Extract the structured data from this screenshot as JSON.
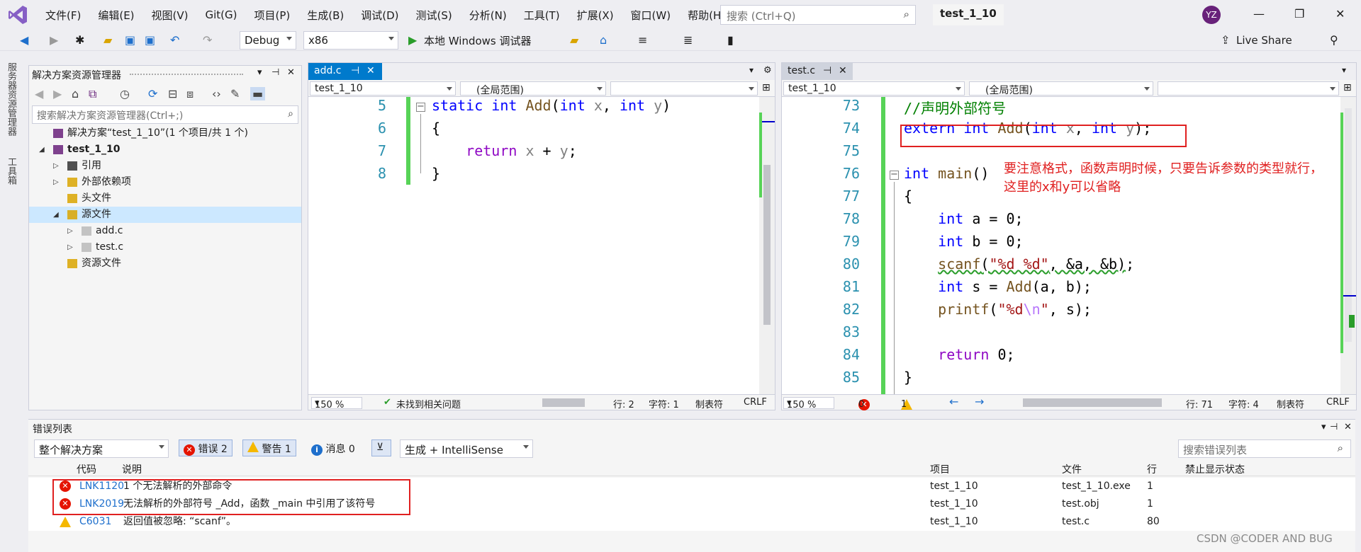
{
  "menu": [
    "文件(F)",
    "编辑(E)",
    "视图(V)",
    "Git(G)",
    "项目(P)",
    "生成(B)",
    "调试(D)",
    "测试(S)",
    "分析(N)",
    "工具(T)",
    "扩展(X)",
    "窗口(W)",
    "帮助(H)"
  ],
  "search_placeholder": "搜索 (Ctrl+Q)",
  "solution_title": "test_1_10",
  "user_initials": "YZ",
  "toolbar": {
    "config": "Debug",
    "platform": "x86",
    "run_label": "本地 Windows 调试器",
    "live_share": "Live Share"
  },
  "side_tabs": [
    "服务器资源管理器",
    "工具箱"
  ],
  "solution_explorer": {
    "title": "解决方案资源管理器",
    "search_placeholder": "搜索解决方案资源管理器(Ctrl+;)",
    "tree": [
      {
        "label": "解决方案“test_1_10”(1 个项目/共 1 个)",
        "level": 0,
        "icon": "solution-icon"
      },
      {
        "label": "test_1_10",
        "level": 0,
        "icon": "project-icon",
        "bold": true,
        "expanded": true
      },
      {
        "label": "引用",
        "level": 1,
        "icon": "references-icon"
      },
      {
        "label": "外部依赖项",
        "level": 1,
        "icon": "folder-icon"
      },
      {
        "label": "头文件",
        "level": 1,
        "icon": "folder-icon"
      },
      {
        "label": "源文件",
        "level": 1,
        "icon": "folder-icon",
        "expanded": true,
        "selected": true
      },
      {
        "label": "add.c",
        "level": 2,
        "icon": "c-file-icon"
      },
      {
        "label": "test.c",
        "level": 2,
        "icon": "c-file-icon"
      },
      {
        "label": "资源文件",
        "level": 1,
        "icon": "folder-icon"
      }
    ]
  },
  "editor_left": {
    "tab": "add.c",
    "nav_project": "test_1_10",
    "nav_scope": "(全局范围)",
    "lines": [
      5,
      6,
      7,
      8
    ],
    "zoom": "150 %",
    "status_msg": "未找到相关问题",
    "pos_line": "行: 2",
    "pos_char": "字符: 1",
    "tab_mode": "制表符",
    "eol": "CRLF"
  },
  "editor_right": {
    "tab": "test.c",
    "nav_project": "test_1_10",
    "nav_scope": "(全局范围)",
    "lines": [
      73,
      74,
      75,
      76,
      77,
      78,
      79,
      80,
      81,
      82,
      83,
      84,
      85
    ],
    "zoom": "150 %",
    "errors": "0",
    "warnings": "1",
    "pos_line": "行: 71",
    "pos_char": "字符: 4",
    "tab_mode": "制表符",
    "eol": "CRLF"
  },
  "annotation": "要注意格式，函数声明时候，只要告诉参数的类型就行，这里的x和y可以省略",
  "error_list": {
    "title": "错误列表",
    "scope": "整个解决方案",
    "errors_btn": "错误 2",
    "warnings_btn": "警告 1",
    "messages_btn": "消息 0",
    "source": "生成 + IntelliSense",
    "search_placeholder": "搜索错误列表",
    "columns": [
      "代码",
      "说明",
      "项目",
      "文件",
      "行",
      "禁止显示状态"
    ],
    "rows": [
      {
        "type": "error",
        "code": "LNK1120",
        "desc": "1 个无法解析的外部命令",
        "project": "test_1_10",
        "file": "test_1_10.exe",
        "line": "1"
      },
      {
        "type": "error",
        "code": "LNK2019",
        "desc": "无法解析的外部符号 _Add，函数 _main 中引用了该符号",
        "project": "test_1_10",
        "file": "test.obj",
        "line": "1"
      },
      {
        "type": "warning",
        "code": "C6031",
        "desc": "返回值被忽略: “scanf”。",
        "project": "test_1_10",
        "file": "test.c",
        "line": "80"
      }
    ]
  },
  "watermark": "CSDN @CODER AND BUG"
}
